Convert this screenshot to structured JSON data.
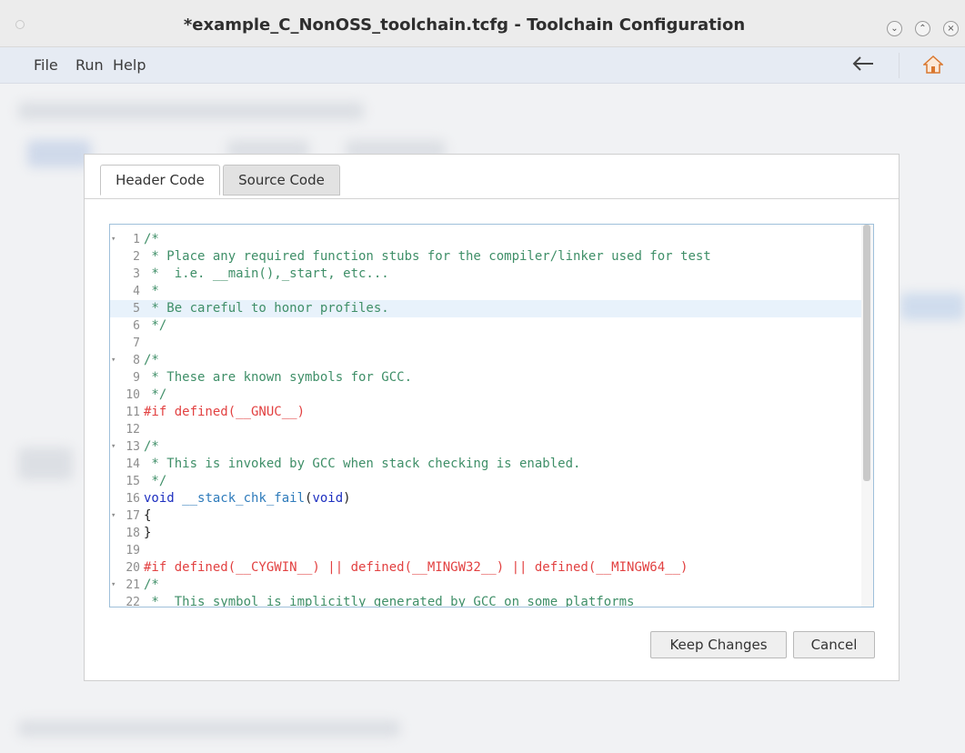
{
  "window": {
    "title": "*example_C_NonOSS_toolchain.tcfg - Toolchain Configuration",
    "controls": [
      "minimize",
      "maximize",
      "close"
    ]
  },
  "menu": {
    "items": [
      "File",
      "Run",
      "Help"
    ],
    "icons": [
      "arrow-left-icon",
      "home-icon"
    ]
  },
  "dialog": {
    "tabs": [
      {
        "label": "Header Code",
        "active": true
      },
      {
        "label": "Source Code",
        "active": false
      }
    ],
    "code_lines": [
      {
        "num": "1",
        "fold": "▾",
        "text": "/*",
        "style": "comment"
      },
      {
        "num": "2",
        "fold": "",
        "text": " * Place any required function stubs for the compiler/linker used for test",
        "style": "comment"
      },
      {
        "num": "3",
        "fold": "",
        "text": " *  i.e. __main(),_start, etc...",
        "style": "comment"
      },
      {
        "num": "4",
        "fold": "",
        "text": " *",
        "style": "comment"
      },
      {
        "num": "5",
        "fold": "",
        "text": " * Be careful to honor profiles.",
        "style": "comment"
      },
      {
        "num": "6",
        "fold": "",
        "text": " */",
        "style": "comment"
      },
      {
        "num": "7",
        "fold": "",
        "text": "",
        "style": "plain"
      },
      {
        "num": "8",
        "fold": "▾",
        "text": "/*",
        "style": "comment"
      },
      {
        "num": "9",
        "fold": "",
        "text": " * These are known symbols for GCC.",
        "style": "comment"
      },
      {
        "num": "10",
        "fold": "",
        "text": " */",
        "style": "comment"
      },
      {
        "num": "11",
        "fold": "",
        "text": "#if defined(__GNUC__)",
        "style": "pre"
      },
      {
        "num": "12",
        "fold": "",
        "text": "",
        "style": "plain"
      },
      {
        "num": "13",
        "fold": "▾",
        "text": "/*",
        "style": "comment"
      },
      {
        "num": "14",
        "fold": "",
        "text": " * This is invoked by GCC when stack checking is enabled.",
        "style": "comment"
      },
      {
        "num": "15",
        "fold": "",
        "text": " */",
        "style": "comment"
      },
      {
        "num": "16",
        "fold": "",
        "text": "void __stack_chk_fail(void)",
        "style": "func"
      },
      {
        "num": "17",
        "fold": "▾",
        "text": "{",
        "style": "plain"
      },
      {
        "num": "18",
        "fold": "",
        "text": "}",
        "style": "plain"
      },
      {
        "num": "19",
        "fold": "",
        "text": "",
        "style": "plain"
      },
      {
        "num": "20",
        "fold": "",
        "text": "#if defined(__CYGWIN__) || defined(__MINGW32__) || defined(__MINGW64__)",
        "style": "pre"
      },
      {
        "num": "21",
        "fold": "▾",
        "text": "/*",
        "style": "comment"
      },
      {
        "num": "22",
        "fold": "",
        "text": " *  This symbol is implicitly generated by GCC on some platforms",
        "style": "comment"
      }
    ],
    "highlighted_line": "5",
    "buttons": {
      "keep": "Keep Changes",
      "cancel": "Cancel"
    }
  }
}
